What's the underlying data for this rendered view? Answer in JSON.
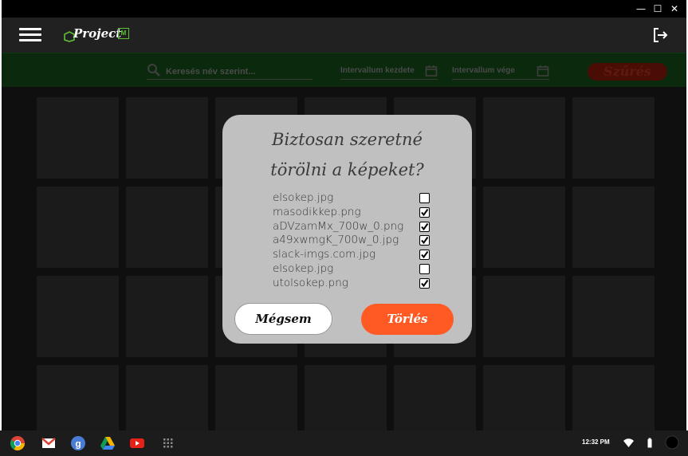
{
  "window": {
    "minimize": "—",
    "maximize": "☐",
    "close": "✕"
  },
  "header": {
    "logo_text": "Project",
    "logo_badge": "M"
  },
  "filter": {
    "search_placeholder": "Keresés név szerint...",
    "interval_start": "Intervallum kezdete",
    "interval_end": "Intervallum vége",
    "filter_button": "Szűrés"
  },
  "dialog": {
    "title_line1": "Biztosan szeretné",
    "title_line2": "törölni a képeket?",
    "files": [
      {
        "name": "elsokep.jpg",
        "checked": false
      },
      {
        "name": "masodikkep.png",
        "checked": true
      },
      {
        "name": "aDVzamMx_700w_0.png",
        "checked": true
      },
      {
        "name": "a49xwmgK_700w_0.jpg",
        "checked": true
      },
      {
        "name": "slack-imgs.com.jpg",
        "checked": true
      },
      {
        "name": "elsokep.jpg",
        "checked": false
      },
      {
        "name": "utolsokep.png",
        "checked": true
      }
    ],
    "cancel_label": "Mégsem",
    "delete_label": "Törlés"
  },
  "taskbar": {
    "apps": [
      "chrome-icon",
      "gmail-icon",
      "google-search-icon",
      "drive-icon",
      "youtube-icon",
      "app-launcher-icon"
    ],
    "clock": "12:32 PM"
  },
  "colors": {
    "accent": "#ff5a23",
    "filterbar": "#0b2a0d",
    "dialog_bg": "#c0c0c0"
  }
}
